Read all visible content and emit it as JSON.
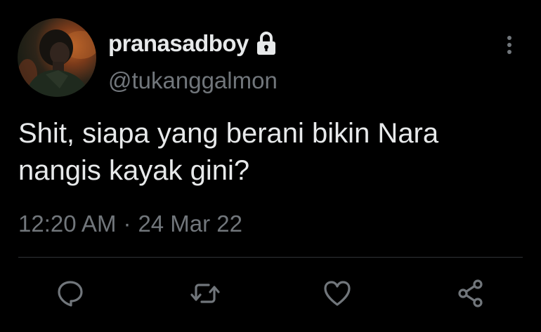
{
  "tweet": {
    "display_name": "pranasadboy",
    "handle": "@tukanggalmon",
    "text_line1": "Shit, siapa yang berani bikin Nara",
    "text_line2": "nangis kayak gini?",
    "time": "12:20 AM",
    "separator": "·",
    "date": "24 Mar 22",
    "protected": true
  },
  "icons": {
    "lock": "lock-icon",
    "more": "more-vertical-icon",
    "reply": "reply-icon",
    "retweet": "retweet-icon",
    "like": "like-icon",
    "share": "share-icon"
  },
  "colors": {
    "background": "#000000",
    "primary_text": "#e7e9ea",
    "secondary_text": "#71767b",
    "divider": "#2f3336"
  }
}
